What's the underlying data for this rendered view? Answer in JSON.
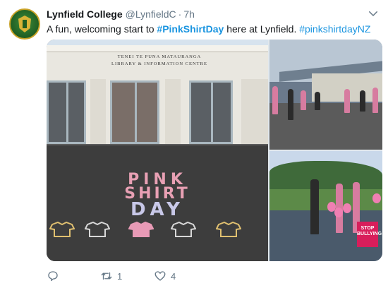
{
  "account": {
    "name": "Lynfield College",
    "handle": "@LynfieldC",
    "separator": "·",
    "time": "7h"
  },
  "tweet": {
    "text_pre": "A fun, welcoming start to ",
    "hashtag_1": "#PinkShirtDay",
    "text_mid": " here at Lynfield. ",
    "hashtag_2": "#pinkshirtdayNZ"
  },
  "images": {
    "main_sign_line1": "TENEI TE PUNA MATAURANGA",
    "main_sign_line2": "LIBRARY & INFORMATION CENTRE",
    "chalk_line1": "PINK",
    "chalk_line2": "SHIRT",
    "chalk_line3": "DAY",
    "stop_sign_line1": "STOP",
    "stop_sign_line2": "BULLYING"
  },
  "actions": {
    "reply_count": "",
    "retweet_count": "1",
    "like_count": "4"
  },
  "colors": {
    "link": "#1b95e0",
    "meta": "#657786",
    "pink": "#e8a0b4"
  },
  "icons": [
    "chevron-down-icon",
    "reply-icon",
    "retweet-icon",
    "heart-icon"
  ]
}
